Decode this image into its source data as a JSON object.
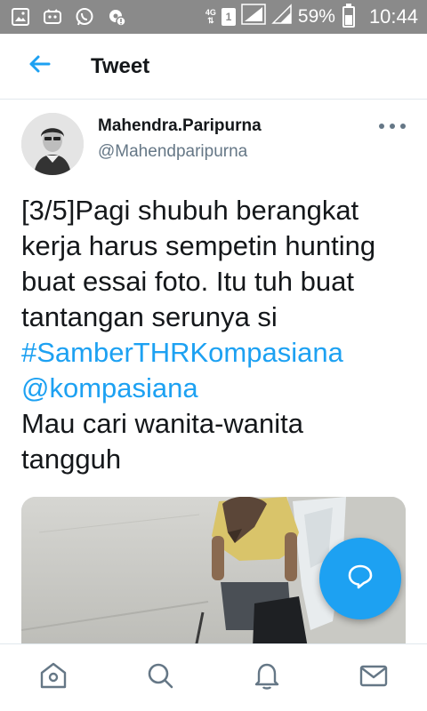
{
  "status_bar": {
    "network": "4G",
    "sim": "1",
    "battery_percent": "59%",
    "battery_level": 0.59,
    "time": "10:44",
    "icons": [
      "gallery-icon",
      "android-icon",
      "whatsapp-icon",
      "settings-alert-icon",
      "signal-icon",
      "signal-icon",
      "battery-icon"
    ]
  },
  "header": {
    "title": "Tweet",
    "back_icon": "arrow-left-icon"
  },
  "tweet": {
    "display_name": "Mahendra.Paripurna",
    "handle": "@Mahendparipurna",
    "more_icon": "more-horizontal-icon",
    "lines": [
      "[3/5]Pagi shubuh berangkat",
      "kerja harus sempetin hunting",
      "buat essai foto. Itu tuh buat",
      "tantangan serunya si"
    ],
    "hashtag": "#SamberTHRKompasiana",
    "mention": "@kompasiana",
    "lines_after": [
      "Mau cari wanita-wanita",
      "tangguh"
    ]
  },
  "fab": {
    "icon": "compose-reply-icon"
  },
  "bottom_nav": {
    "items": [
      "home-icon",
      "search-icon",
      "notifications-icon",
      "messages-icon"
    ]
  },
  "colors": {
    "accent": "#1da1f2",
    "text": "#14171a",
    "secondary": "#657786",
    "status_bar": "#8a8a8a"
  }
}
